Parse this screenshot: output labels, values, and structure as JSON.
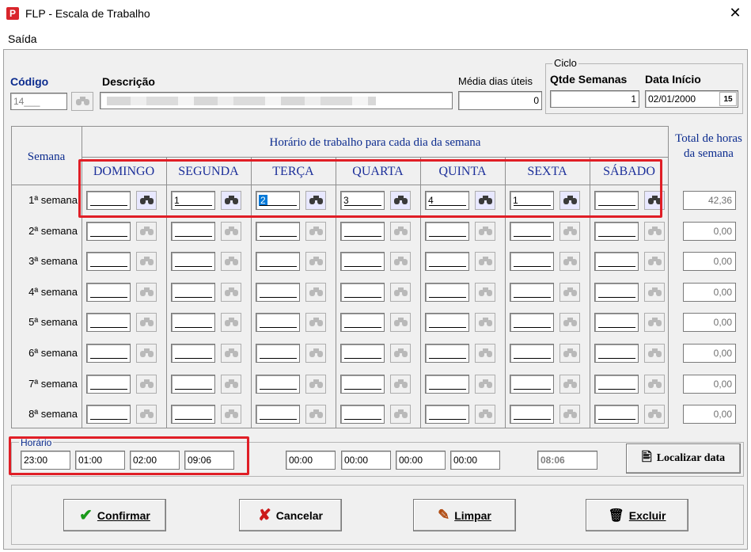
{
  "window": {
    "title": "FLP - Escala de Trabalho",
    "app_icon": "P",
    "close": "✕"
  },
  "menu": {
    "items": [
      "Saída"
    ]
  },
  "header": {
    "codigo_label": "Código",
    "codigo_value": "14___",
    "descricao_label": "Descrição",
    "media_label": "Média dias úteis",
    "media_value": "0",
    "ciclo_label": "Ciclo",
    "qtde_label": "Qtde Semanas",
    "qtde_value": "1",
    "data_inicio_label": "Data Início",
    "data_inicio_value": "02/01/2000",
    "calendar_button": "15"
  },
  "grid": {
    "semana_header": "Semana",
    "horario_header": "Horário de trabalho para cada dia da semana",
    "total_header": "Total de horas da semana",
    "days": [
      "DOMINGO",
      "SEGUNDA",
      "TERÇA",
      "QUARTA",
      "QUINTA",
      "SEXTA",
      "SÁBADO"
    ],
    "rows": [
      {
        "label": "1ª semana",
        "values": [
          "",
          "1",
          "2",
          "3",
          "4",
          "1",
          ""
        ],
        "total": "42,36"
      },
      {
        "label": "2ª semana",
        "values": [
          "",
          "",
          "",
          "",
          "",
          "",
          ""
        ],
        "total": "0,00"
      },
      {
        "label": "3ª semana",
        "values": [
          "",
          "",
          "",
          "",
          "",
          "",
          ""
        ],
        "total": "0,00"
      },
      {
        "label": "4ª semana",
        "values": [
          "",
          "",
          "",
          "",
          "",
          "",
          ""
        ],
        "total": "0,00"
      },
      {
        "label": "5ª semana",
        "values": [
          "",
          "",
          "",
          "",
          "",
          "",
          ""
        ],
        "total": "0,00"
      },
      {
        "label": "6ª semana",
        "values": [
          "",
          "",
          "",
          "",
          "",
          "",
          ""
        ],
        "total": "0,00"
      },
      {
        "label": "7ª semana",
        "values": [
          "",
          "",
          "",
          "",
          "",
          "",
          ""
        ],
        "total": "0,00"
      },
      {
        "label": "8ª semana",
        "values": [
          "",
          "",
          "",
          "",
          "",
          "",
          ""
        ],
        "total": "0,00"
      }
    ]
  },
  "horario": {
    "label": "Horário",
    "times": [
      "23:00",
      "01:00",
      "02:00",
      "09:06"
    ],
    "times2": [
      "00:00",
      "00:00",
      "00:00",
      "00:00"
    ],
    "total": "08:06",
    "localizar": "Localizar data"
  },
  "buttons": {
    "confirmar": "Confirmar",
    "cancelar": "Cancelar",
    "limpar": "Limpar",
    "excluir": "Excluir"
  },
  "colors": {
    "highlight": "#e01e26",
    "header_blue": "#1c2f9a",
    "selection": "#0078d7"
  }
}
